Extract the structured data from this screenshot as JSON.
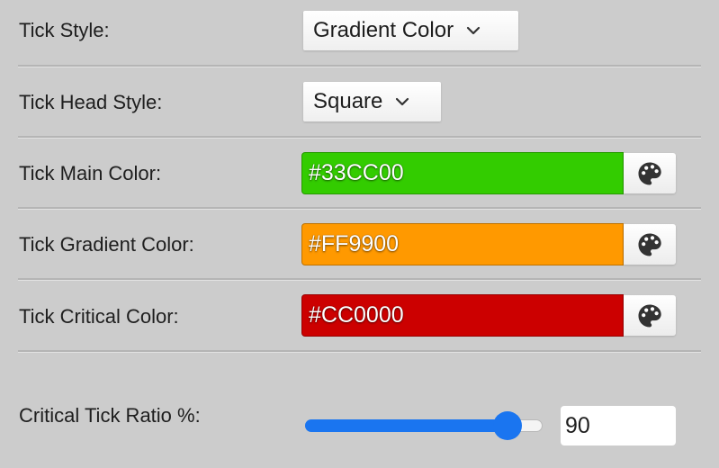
{
  "fields": {
    "tick_style": {
      "label": "Tick Style:",
      "value": "Gradient Color"
    },
    "tick_head_style": {
      "label": "Tick Head Style:",
      "value": "Square"
    },
    "tick_main_color": {
      "label": "Tick Main Color:",
      "value": "#33CC00",
      "color": "#33CC00"
    },
    "tick_gradient_color": {
      "label": "Tick Gradient Color:",
      "value": "#FF9900",
      "color": "#FF9900"
    },
    "tick_critical_color": {
      "label": "Tick Critical Color:",
      "value": "#CC0000",
      "color": "#CC0000"
    },
    "critical_tick_ratio": {
      "label": "Critical Tick Ratio %:",
      "value": "90",
      "slider_fraction": 0.9
    }
  },
  "icons": {
    "dropdown": "chevron-down-icon",
    "color_picker": "palette-icon"
  },
  "theme": {
    "background": "#cccccc",
    "accent": "#1a75f0"
  }
}
